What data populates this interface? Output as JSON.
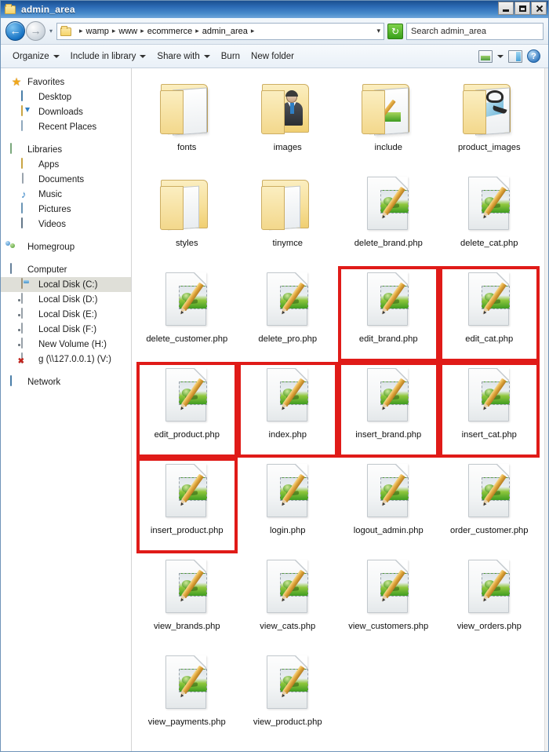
{
  "window": {
    "title": "admin_area",
    "title_icon": "folder-icon",
    "controls": [
      {
        "name": "minimize-button",
        "glyph": "minimize-icon"
      },
      {
        "name": "maximize-button",
        "glyph": "maximize-icon"
      },
      {
        "name": "close-button",
        "glyph": "close-icon"
      }
    ]
  },
  "address_bar": {
    "back_label": "←",
    "forward_label": "→",
    "recent_dropdown_label": "▾",
    "path_icon": "folder-icon",
    "breadcrumbs": [
      "wamp",
      "www",
      "ecommerce",
      "admin_area"
    ],
    "breadcrumb_separator": "▸",
    "path_dropdown_label": "▾",
    "refresh_label": "↻",
    "search_value": "Search admin_area",
    "search_placeholder": "Search admin_area"
  },
  "command_bar": {
    "items": [
      {
        "label": "Organize",
        "has_caret": true
      },
      {
        "label": "Include in library",
        "has_caret": true
      },
      {
        "label": "Share with",
        "has_caret": true
      },
      {
        "label": "Burn",
        "has_caret": false
      },
      {
        "label": "New folder",
        "has_caret": false
      }
    ],
    "view_icon": "view-options-icon",
    "view_caret": "▾",
    "preview_icon": "preview-pane-icon",
    "help_label": "?"
  },
  "sidebar": {
    "groups": [
      {
        "header": {
          "label": "Favorites",
          "icon": "star-icon",
          "icon_class": "ico-star",
          "glyph": "★"
        },
        "items": [
          {
            "label": "Desktop",
            "icon": "desktop-icon",
            "icon_class": "ico-desktop"
          },
          {
            "label": "Downloads",
            "icon": "downloads-icon",
            "icon_class": "ico-download"
          },
          {
            "label": "Recent Places",
            "icon": "recent-places-icon",
            "icon_class": "ico-recent"
          }
        ]
      },
      {
        "header": {
          "label": "Libraries",
          "icon": "libraries-icon",
          "icon_class": "ico-library",
          "glyph": ""
        },
        "items": [
          {
            "label": "Apps",
            "icon": "folder-icon",
            "icon_class": "ico-folder-sm"
          },
          {
            "label": "Documents",
            "icon": "document-icon",
            "icon_class": "ico-doc"
          },
          {
            "label": "Music",
            "icon": "music-icon",
            "icon_class": "ico-music",
            "glyph": "♪"
          },
          {
            "label": "Pictures",
            "icon": "pictures-icon",
            "icon_class": "ico-picture"
          },
          {
            "label": "Videos",
            "icon": "videos-icon",
            "icon_class": "ico-video"
          }
        ]
      },
      {
        "header": {
          "label": "Homegroup",
          "icon": "homegroup-icon",
          "icon_class": "ico-homegroup",
          "glyph": ""
        },
        "items": []
      },
      {
        "header": {
          "label": "Computer",
          "icon": "computer-icon",
          "icon_class": "ico-computer",
          "glyph": ""
        },
        "items": [
          {
            "label": "Local Disk (C:)",
            "icon": "hard-disk-icon",
            "icon_class": "ico-disk-c",
            "selected": true
          },
          {
            "label": "Local Disk (D:)",
            "icon": "hard-disk-icon",
            "icon_class": "ico-disk"
          },
          {
            "label": "Local Disk (E:)",
            "icon": "hard-disk-icon",
            "icon_class": "ico-disk"
          },
          {
            "label": "Local Disk (F:)",
            "icon": "hard-disk-icon",
            "icon_class": "ico-disk"
          },
          {
            "label": "New Volume (H:)",
            "icon": "hard-disk-icon",
            "icon_class": "ico-disk"
          },
          {
            "label": "g (\\\\127.0.0.1) (V:)",
            "icon": "disconnected-network-drive-icon",
            "icon_class": "ico-netdrive"
          }
        ]
      },
      {
        "header": {
          "label": "Network",
          "icon": "network-icon",
          "icon_class": "ico-network",
          "glyph": ""
        },
        "items": []
      }
    ]
  },
  "content": {
    "highlight_color": "#e01b18",
    "items": [
      {
        "name": "fonts",
        "type": "folder",
        "overlay": "papers",
        "highlighted": false
      },
      {
        "name": "images",
        "type": "folder",
        "overlay": "person",
        "highlighted": false
      },
      {
        "name": "include",
        "type": "folder",
        "overlay": "pencil",
        "highlighted": false
      },
      {
        "name": "product_images",
        "type": "folder",
        "overlay": "shoe",
        "highlighted": false
      },
      {
        "name": "styles",
        "type": "folder",
        "overlay": "plain",
        "highlighted": false
      },
      {
        "name": "tinymce",
        "type": "folder",
        "overlay": "plain",
        "highlighted": false
      },
      {
        "name": "delete_brand.php",
        "type": "php-file",
        "highlighted": false
      },
      {
        "name": "delete_cat.php",
        "type": "php-file",
        "highlighted": false
      },
      {
        "name": "delete_customer.php",
        "type": "php-file",
        "highlighted": false
      },
      {
        "name": "delete_pro.php",
        "type": "php-file",
        "highlighted": false
      },
      {
        "name": "edit_brand.php",
        "type": "php-file",
        "highlighted": true
      },
      {
        "name": "edit_cat.php",
        "type": "php-file",
        "highlighted": true
      },
      {
        "name": "edit_product.php",
        "type": "php-file",
        "highlighted": true
      },
      {
        "name": "index.php",
        "type": "php-file",
        "highlighted": true
      },
      {
        "name": "insert_brand.php",
        "type": "php-file",
        "highlighted": true
      },
      {
        "name": "insert_cat.php",
        "type": "php-file",
        "highlighted": true
      },
      {
        "name": "insert_product.php",
        "type": "php-file",
        "highlighted": true
      },
      {
        "name": "login.php",
        "type": "php-file",
        "highlighted": false
      },
      {
        "name": "logout_admin.php",
        "type": "php-file",
        "highlighted": false
      },
      {
        "name": "order_customer.php",
        "type": "php-file",
        "highlighted": false
      },
      {
        "name": "view_brands.php",
        "type": "php-file",
        "highlighted": false
      },
      {
        "name": "view_cats.php",
        "type": "php-file",
        "highlighted": false
      },
      {
        "name": "view_customers.php",
        "type": "php-file",
        "highlighted": false
      },
      {
        "name": "view_orders.php",
        "type": "php-file",
        "highlighted": false
      },
      {
        "name": "view_payments.php",
        "type": "php-file",
        "highlighted": false
      },
      {
        "name": "view_product.php",
        "type": "php-file",
        "highlighted": false
      }
    ]
  }
}
